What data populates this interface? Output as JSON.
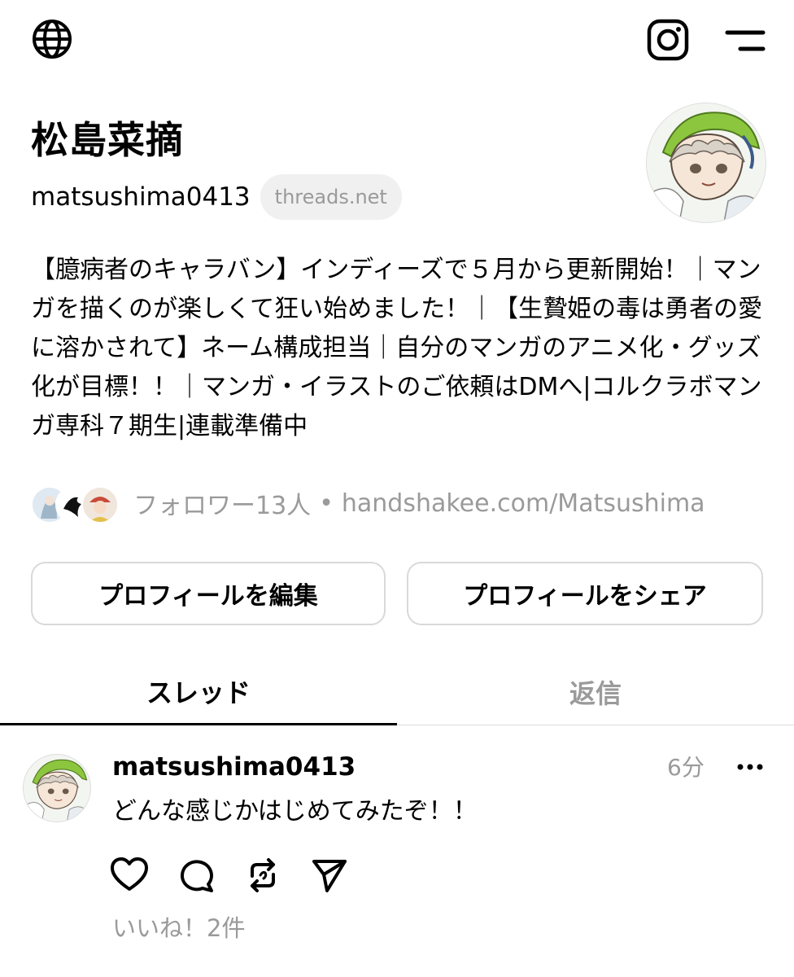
{
  "header": {
    "globe_icon": "globe-icon",
    "instagram_icon": "instagram-icon",
    "menu_icon": "menu-icon"
  },
  "profile": {
    "name": "松島菜摘",
    "handle": "matsushima0413",
    "domain_badge": "threads.net",
    "bio": "【臆病者のキャラバン】インディーズで５月から更新開始！｜マンガを描くのが楽しくて狂い始めました！｜【生贄姫の毒は勇者の愛に溶かされて】ネーム構成担当｜自分のマンガのアニメ化・グッズ化が目標！！｜マンガ・イラストのご依頼はDMへ|コルクラボマンガ専科７期生|連載準備中",
    "followers": "フォロワー13人",
    "separator": "•",
    "link": "handshakee.com/Matsushima"
  },
  "buttons": {
    "edit": "プロフィールを編集",
    "share": "プロフィールをシェア"
  },
  "tabs": [
    {
      "label": "スレッド",
      "active": true
    },
    {
      "label": "返信",
      "active": false
    }
  ],
  "post": {
    "username": "matsushima0413",
    "time": "6分",
    "text": "どんな感じかはじめてみたぞ！！",
    "likes": "いいね！2件",
    "more_icon": "more-icon",
    "actions": [
      "heart-icon",
      "comment-icon",
      "repost-icon",
      "send-icon"
    ]
  },
  "colors": {
    "text": "#000000",
    "muted": "#9a9a9a",
    "border": "#d9d9d9",
    "pill_bg": "#f0f0f0",
    "avatar_green": "#8cc63f"
  }
}
